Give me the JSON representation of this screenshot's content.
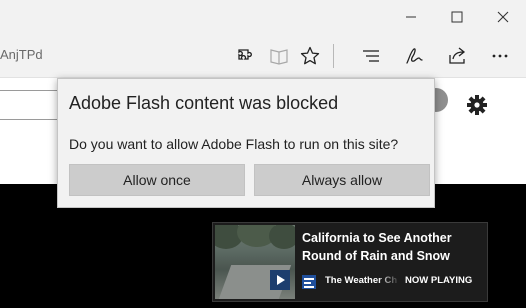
{
  "window": {
    "minimize_icon": "minimize-icon",
    "maximize_icon": "maximize-icon",
    "close_icon": "close-icon"
  },
  "toolbar": {
    "url_fragment": "AnjTPd",
    "icons": [
      "extensions-icon",
      "reading-view-icon",
      "favorites-star-icon",
      "hub-icon",
      "web-note-icon",
      "share-icon"
    ]
  },
  "flash_prompt": {
    "title": "Adobe Flash content was blocked",
    "question": "Do you want to allow Adobe Flash to run on this site?",
    "allow_once_label": "Allow once",
    "always_allow_label": "Always allow"
  },
  "news_card": {
    "headline": "California to See Another Round of Rain and Snow",
    "source": "The Weather Ch",
    "status": "NOW PLAYING"
  },
  "colors": {
    "chrome_bg": "#f2f2f2",
    "popup_bg": "#f2f2f2",
    "button_bg": "#cccccc",
    "video_bg": "#000000",
    "card_bg": "#1c1c1c",
    "weather_blue": "#1f4f9c"
  }
}
